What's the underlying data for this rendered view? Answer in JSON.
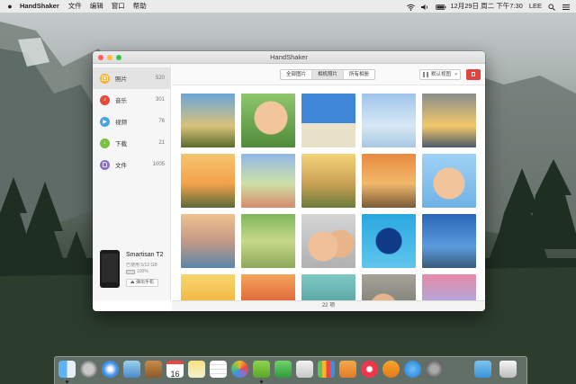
{
  "menubar": {
    "app_name": "HandShaker",
    "menus": [
      "文件",
      "编辑",
      "窗口",
      "帮助"
    ],
    "user": "LEE",
    "datetime": "12月29日 周二 下午7:30"
  },
  "window": {
    "title": "HandShaker",
    "sidebar": [
      {
        "label": "照片",
        "count": "520",
        "color": "#f3b43a",
        "icon": "photo-icon",
        "active": true
      },
      {
        "label": "音乐",
        "count": "301",
        "color": "#e44a3c",
        "icon": "music-icon"
      },
      {
        "label": "视频",
        "count": "76",
        "color": "#4aa3df",
        "icon": "video-icon"
      },
      {
        "label": "下载",
        "count": "21",
        "color": "#7ac142",
        "icon": "download-icon"
      },
      {
        "label": "文件",
        "count": "1005",
        "color": "#8c6fd1",
        "icon": "file-icon"
      }
    ],
    "device": {
      "name": "Smartisan T2",
      "storage": "已使用 5/12 GB",
      "battery": "100%",
      "eject_label": "弹出手机"
    },
    "tabs": [
      "全部图片",
      "相机照片",
      "所有相册"
    ],
    "active_tab": 1,
    "view_label": "默认视图",
    "photo_count": "22 项"
  },
  "dock": {
    "apps": [
      "finder-icon",
      "launchpad-icon",
      "safari-icon",
      "preview-icon",
      "contacts-icon",
      "calendar-icon",
      "notes-icon",
      "reminders-icon",
      "photos-icon",
      "handshaker-icon",
      "facetime-icon",
      "keynote-icon",
      "numbers-icon",
      "pages-icon",
      "music-icon",
      "ibooks-icon",
      "appstore-icon",
      "system-preferences-icon",
      "downloads-folder-icon",
      "trash-icon"
    ],
    "calendar_day": "16"
  }
}
